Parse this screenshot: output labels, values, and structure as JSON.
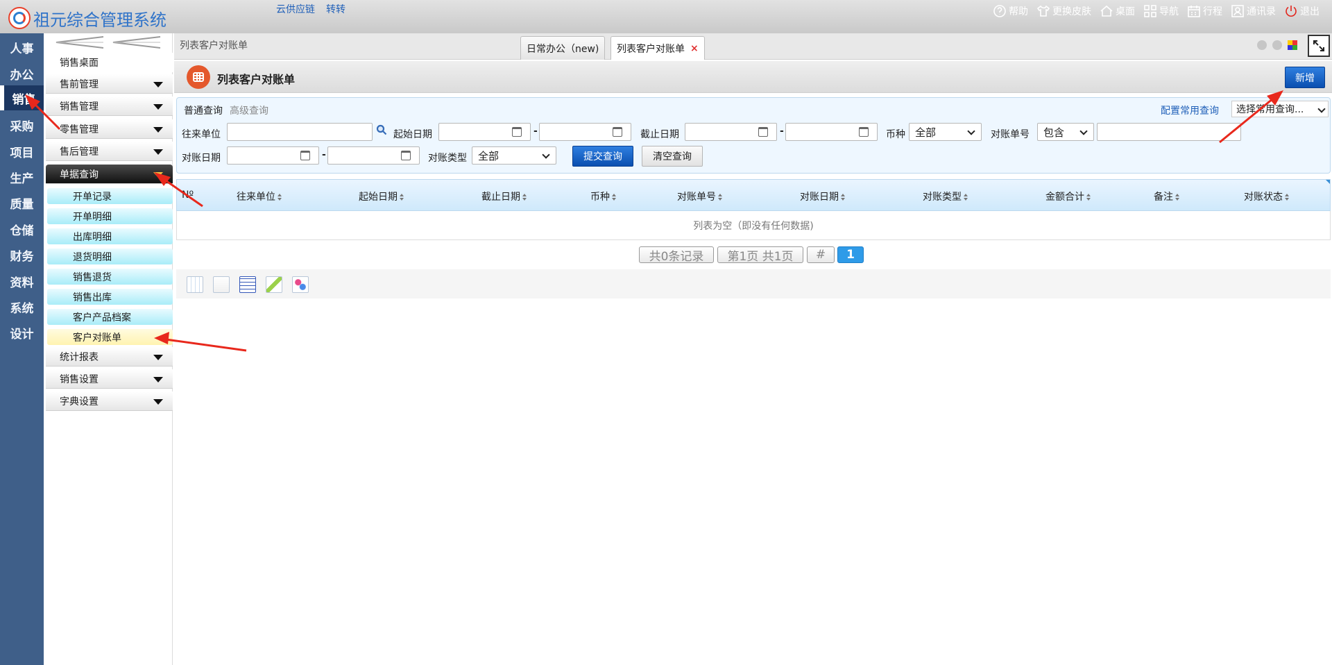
{
  "app": {
    "title": "祖元综合管理系统",
    "links": [
      "云供应链",
      "转转"
    ],
    "tools": [
      {
        "label": "帮助",
        "icon": "help-icon"
      },
      {
        "label": "更换皮肤",
        "icon": "shirt-icon"
      },
      {
        "label": "桌面",
        "icon": "home-icon"
      },
      {
        "label": "导航",
        "icon": "grid-icon"
      },
      {
        "label": "行程",
        "icon": "calendar-icon"
      },
      {
        "label": "通讯录",
        "icon": "contacts-icon"
      },
      {
        "label": "退出",
        "icon": "power-icon"
      }
    ]
  },
  "leftnav": {
    "items": [
      "人事",
      "办公",
      "销售",
      "采购",
      "项目",
      "生产",
      "质量",
      "仓储",
      "财务",
      "资料",
      "系统",
      "设计"
    ],
    "active": "销售"
  },
  "submenu": {
    "groups": [
      {
        "label": "销售桌面"
      },
      {
        "label": "售前管理"
      },
      {
        "label": "销售管理"
      },
      {
        "label": "零售管理"
      },
      {
        "label": "售后管理"
      },
      {
        "label": "单据查询"
      },
      {
        "label": "统计报表"
      },
      {
        "label": "销售设置"
      },
      {
        "label": "字典设置"
      }
    ],
    "leaves": [
      "开单记录",
      "开单明细",
      "出库明细",
      "退货明细",
      "销售退货",
      "销售出库",
      "客户产品档案",
      "客户对账单"
    ],
    "current_leaf": "客户对账单"
  },
  "tabs": {
    "breadcrumb": "列表客户对账单",
    "items": [
      {
        "label": "日常办公（new)"
      },
      {
        "label": "列表客户对账单",
        "close": "×"
      }
    ]
  },
  "page": {
    "title": "列表客户对账单",
    "add_label": "新增"
  },
  "query": {
    "tab_normal": "普通查询",
    "tab_advanced": "高级查询",
    "config_link": "配置常用查询",
    "common_select": "选择常用查询...",
    "labels": {
      "partner": "往来单位",
      "start_date": "起始日期",
      "end_date": "截止日期",
      "currency": "币种",
      "stmt_no": "对账单号",
      "stmt_date": "对账日期",
      "stmt_type": "对账类型"
    },
    "dash": "-",
    "currency_value": "全部",
    "stmt_no_op": "包含",
    "stmt_type_value": "全部",
    "submit_label": "提交查询",
    "clear_label": "清空查询"
  },
  "table": {
    "columns": [
      "Nº",
      "往来单位",
      "起始日期",
      "截止日期",
      "币种",
      "对账单号",
      "对账日期",
      "对账类型",
      "金额合计",
      "备注",
      "对账状态"
    ],
    "empty_text": "列表为空（即没有任何数据)"
  },
  "pager": {
    "total": "共0条记录",
    "page_info": "第1页 共1页",
    "hash": "#",
    "current": "1"
  }
}
